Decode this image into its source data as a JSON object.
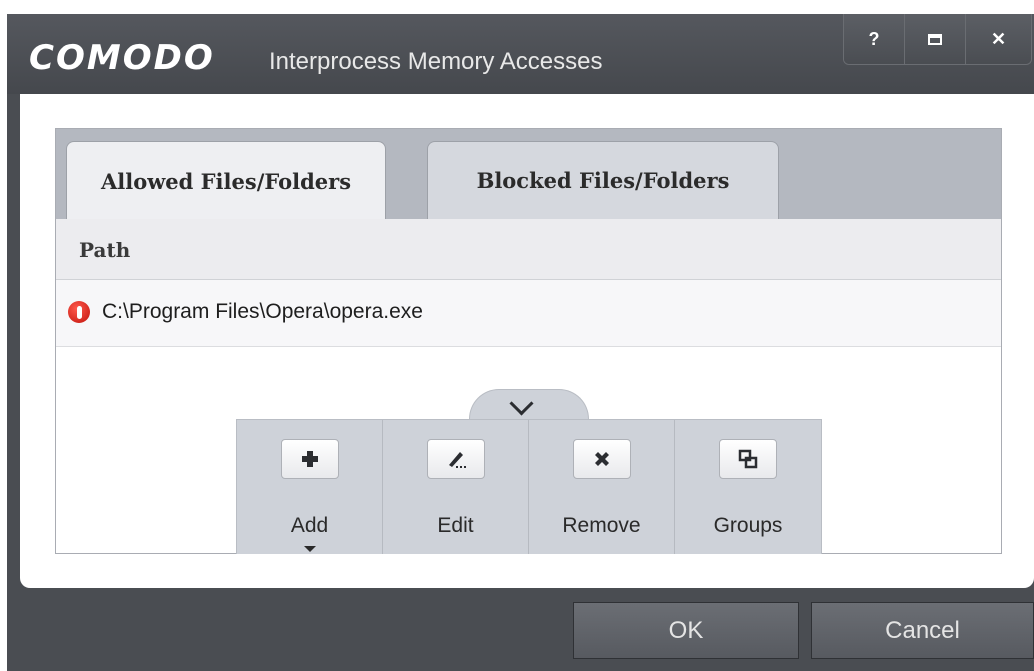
{
  "window": {
    "brand": "COMODO",
    "title": "Interprocess Memory Accesses",
    "controls": {
      "help": "?",
      "close": "✕"
    }
  },
  "tabs": [
    {
      "label": "Allowed Files/Folders",
      "active": true
    },
    {
      "label": "Blocked Files/Folders",
      "active": false
    }
  ],
  "table": {
    "header": "Path",
    "rows": [
      {
        "icon": "opera-icon",
        "path": "C:\\Program Files\\Opera\\opera.exe"
      }
    ]
  },
  "toolbar": {
    "add": "Add",
    "edit": "Edit",
    "remove": "Remove",
    "groups": "Groups"
  },
  "buttons": {
    "ok": "OK",
    "cancel": "Cancel"
  },
  "colors": {
    "titlebar": "#4a4d52",
    "opera_red": "#c1120b",
    "toolbar": "#ced2d9"
  }
}
